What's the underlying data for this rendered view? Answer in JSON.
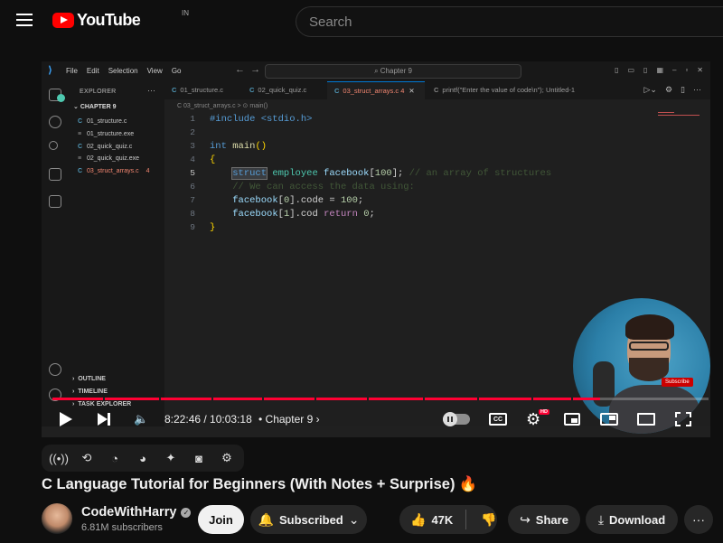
{
  "header": {
    "logo_text": "YouTube",
    "country_code": "IN",
    "search_placeholder": "Search"
  },
  "vscode": {
    "menu": [
      "File",
      "Edit",
      "Selection",
      "View",
      "Go"
    ],
    "command_center": "Chapter 9",
    "explorer_title": "EXPLORER",
    "folder": "CHAPTER 9",
    "files": [
      {
        "name": "01_structure.c",
        "kind": "c"
      },
      {
        "name": "01_structure.exe",
        "kind": "exe"
      },
      {
        "name": "02_quick_quiz.c",
        "kind": "c"
      },
      {
        "name": "02_quick_quiz.exe",
        "kind": "exe"
      },
      {
        "name": "03_struct_arrays.c",
        "kind": "c",
        "badge": "4"
      }
    ],
    "outline": "OUTLINE",
    "timeline": "TIMELINE",
    "task_explorer": "TASK EXPLORER",
    "tabs": [
      "01_structure.c",
      "02_quick_quiz.c",
      "03_struct_arrays.c",
      "printf(\"Enter the value of code\\n\"); Untitled-1"
    ],
    "active_tab_badge": "4",
    "breadcrumb": "C 03_struct_arrays.c > ⊙ main()",
    "line_numbers": [
      "1",
      "2",
      "3",
      "4",
      "5",
      "6",
      "7",
      "8",
      "9"
    ],
    "code_lines": {
      "l1": "#include <stdio.h>",
      "l3_kw": "int",
      "l3_fn": "main",
      "l3_rest": "()",
      "l4": "{",
      "l5_kw": "struct",
      "l5_rest": " employee ",
      "l5_var": "facebook",
      "l5_num": "100",
      "l5_com": "// an array of structures",
      "l6_com": "// We can access the data using:",
      "l7_var": "facebook",
      "l7_idx": "0",
      "l7_field": ".code = ",
      "l7_num": "100",
      "l8_var": "facebook",
      "l8_idx": "1",
      "l8_field": ".cod ",
      "l8_kw": "return",
      "l8_num": "0",
      "l9": "}"
    },
    "webcam_badge": "Subscribe"
  },
  "player": {
    "time": "8:22:46 / 10:03:18",
    "chapter": "Chapter 9",
    "quality_badge": "HD",
    "progress": 0.835
  },
  "video": {
    "title": "C Language Tutorial for Beginners (With Notes + Surprise)",
    "title_emoji": "🔥"
  },
  "channel": {
    "name": "CodeWithHarry",
    "subscribers": "6.81M subscribers"
  },
  "actions": {
    "join": "Join",
    "subscribed": "Subscribed",
    "likes": "47K",
    "share": "Share",
    "download": "Download"
  }
}
